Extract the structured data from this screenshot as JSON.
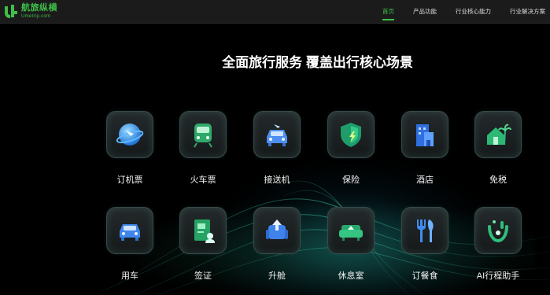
{
  "brand": {
    "name": "航旅纵横",
    "url": "Umetrip.com",
    "accent": "#3fbf49"
  },
  "nav": {
    "items": [
      {
        "label": "首页",
        "active": true
      },
      {
        "label": "产品功能",
        "active": false
      },
      {
        "label": "行业核心能力",
        "active": false
      },
      {
        "label": "行业解决方案",
        "active": false
      }
    ]
  },
  "headline": "全面旅行服务 覆盖出行核心场景",
  "services": [
    {
      "label": "订机票",
      "icon": "globe-plane-icon"
    },
    {
      "label": "火车票",
      "icon": "train-icon"
    },
    {
      "label": "接送机",
      "icon": "car-plane-icon"
    },
    {
      "label": "保险",
      "icon": "shield-icon"
    },
    {
      "label": "酒店",
      "icon": "hotel-building-icon"
    },
    {
      "label": "免税",
      "icon": "palm-house-icon"
    },
    {
      "label": "用车",
      "icon": "car-icon"
    },
    {
      "label": "签证",
      "icon": "visa-document-icon"
    },
    {
      "label": "升舱",
      "icon": "seat-upgrade-icon"
    },
    {
      "label": "休息室",
      "icon": "lounge-sofa-icon"
    },
    {
      "label": "订餐食",
      "icon": "fork-knife-icon"
    },
    {
      "label": "AI行程助手",
      "icon": "ai-assistant-icon"
    }
  ]
}
